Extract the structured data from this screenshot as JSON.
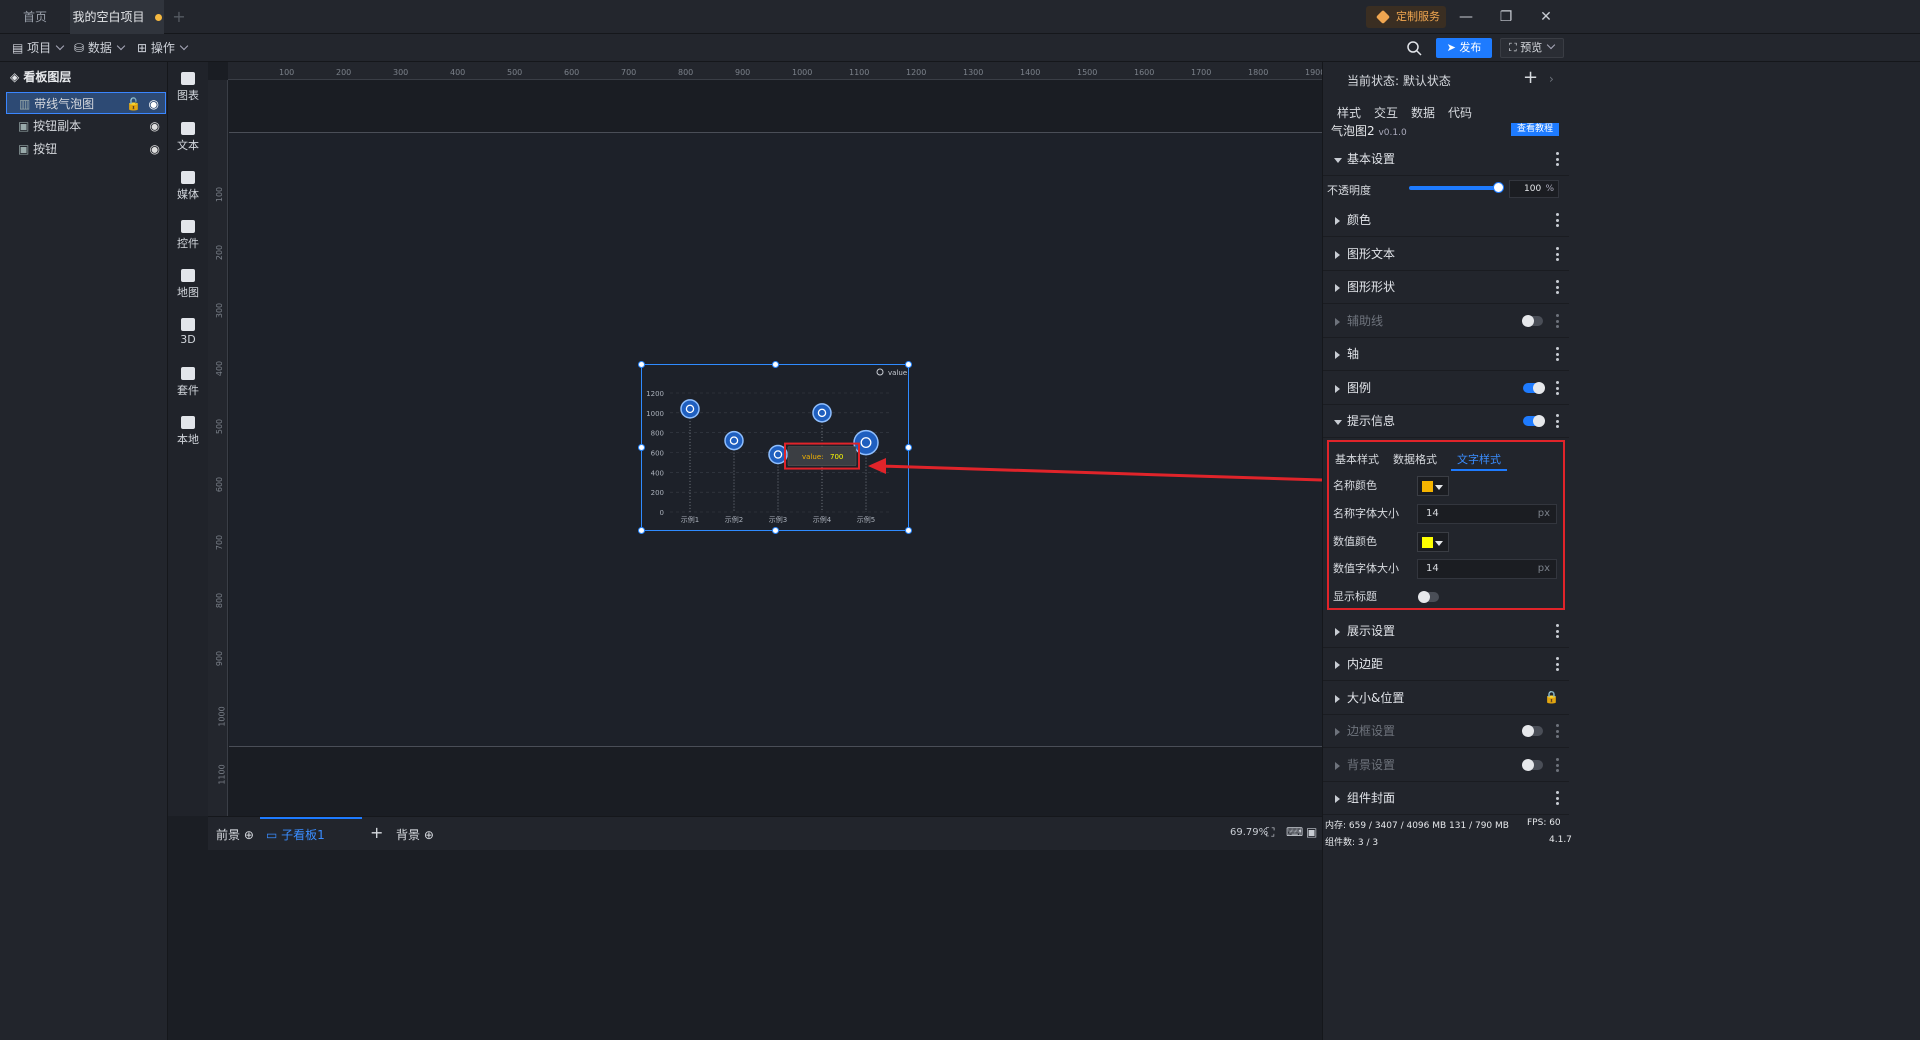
{
  "tabs": [
    {
      "label": "首页"
    },
    {
      "label": "我的空白项目"
    }
  ],
  "window": {
    "custom_service": "定制服务"
  },
  "toolbar": {
    "project": "项目",
    "data": "数据",
    "operate": "操作",
    "publish": "发布",
    "preview": "预览"
  },
  "layers": {
    "title": "看板图层",
    "items": [
      {
        "label": "带线气泡图"
      },
      {
        "label": "按钮副本"
      },
      {
        "label": "按钮"
      }
    ]
  },
  "components": [
    {
      "label": "图表",
      "icon": "chart-icon"
    },
    {
      "label": "文本",
      "icon": "text-icon"
    },
    {
      "label": "媒体",
      "icon": "media-icon"
    },
    {
      "label": "控件",
      "icon": "control-icon"
    },
    {
      "label": "地图",
      "icon": "map-icon"
    },
    {
      "label": "3D",
      "icon": "cube-icon"
    },
    {
      "label": "套件",
      "icon": "kit-icon"
    },
    {
      "label": "本地",
      "icon": "puzzle-icon"
    }
  ],
  "ruler": {
    "top": [
      "100",
      "200",
      "300",
      "400",
      "500",
      "600",
      "700",
      "800",
      "900",
      "1000",
      "1100",
      "1200",
      "1300",
      "1400",
      "1500",
      "1600",
      "1700",
      "1800",
      "1900"
    ],
    "left": [
      "100",
      "200",
      "300",
      "400",
      "500",
      "600",
      "700",
      "800",
      "900",
      "1000",
      "1100"
    ]
  },
  "chart_data": {
    "type": "scatter",
    "legend": "value",
    "categories": [
      "示例1",
      "示例2",
      "示例3",
      "示例4",
      "示例5"
    ],
    "values": [
      1040,
      720,
      580,
      1000,
      700
    ],
    "y_ticks": [
      "1200",
      "1000",
      "800",
      "600",
      "400",
      "200",
      "0"
    ],
    "ylim": [
      0,
      1200
    ],
    "tooltip": {
      "label": "value:",
      "value": "700"
    }
  },
  "bottom": {
    "tabs": [
      {
        "label": "前景"
      },
      {
        "label": "子看板1"
      },
      {
        "label": "背景"
      }
    ],
    "zoom": "69.79%"
  },
  "panel": {
    "state_label": "当前状态: 默认状态",
    "tabs": [
      {
        "label": "样式"
      },
      {
        "label": "交互"
      },
      {
        "label": "数据"
      },
      {
        "label": "代码"
      }
    ],
    "component_name": "气泡图2",
    "version": "v0.1.0",
    "tutorial": "查看教程",
    "opacity_label": "不透明度",
    "opacity_value": "100",
    "opacity_unit": "%",
    "sections": [
      {
        "label": "基本设置"
      },
      {
        "label": "颜色"
      },
      {
        "label": "图形文本"
      },
      {
        "label": "图形形状"
      },
      {
        "label": "辅助线"
      },
      {
        "label": "轴"
      },
      {
        "label": "图例"
      },
      {
        "label": "提示信息"
      },
      {
        "label": "展示设置"
      },
      {
        "label": "内边距"
      },
      {
        "label": "大小&位置"
      },
      {
        "label": "边框设置"
      },
      {
        "label": "背景设置"
      },
      {
        "label": "组件封面"
      }
    ],
    "tooltip_sub_tabs": [
      {
        "label": "基本样式"
      },
      {
        "label": "数据格式"
      },
      {
        "label": "文字样式"
      }
    ],
    "text_style": {
      "name_color_label": "名称颜色",
      "name_color": "#f5b400",
      "name_size_label": "名称字体大小",
      "name_size": "14",
      "value_color_label": "数值颜色",
      "value_color": "#ffff00",
      "value_size_label": "数值字体大小",
      "value_size": "14",
      "unit": "px",
      "show_title_label": "显示标题"
    }
  },
  "status": {
    "memory": "内存: 659 / 3407 / 4096 MB 131 / 790 MB",
    "fps": "FPS: 60",
    "components": "组件数: 3 / 3",
    "version": "4.1.7"
  },
  "colors": {
    "accent": "#1e7bff",
    "highlight": "#e0242a",
    "selection": "#2f8bff"
  }
}
